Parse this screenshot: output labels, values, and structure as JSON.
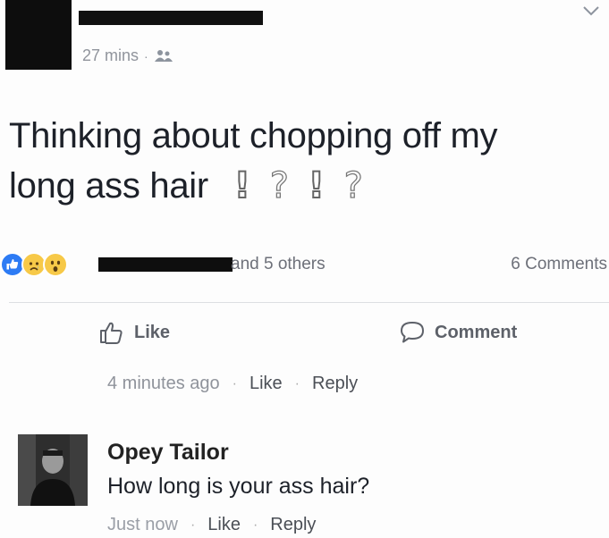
{
  "post": {
    "time": "27 mins",
    "separator": "·",
    "audience_icon": "friends-icon",
    "text_line1": "Thinking about chopping off my",
    "text_line2": "long ass hair",
    "marks": [
      "!",
      "?",
      "!",
      "?"
    ]
  },
  "reactions": {
    "icons": [
      "like-reaction-icon",
      "sad-reaction-icon",
      "wow-reaction-icon"
    ],
    "others_text": "and 5 others",
    "comments_count": "6 Comments"
  },
  "actions": {
    "like_label": "Like",
    "comment_label": "Comment"
  },
  "comment1": {
    "time": "4 minutes ago",
    "like_label": "Like",
    "reply_label": "Reply",
    "dot": "·"
  },
  "comment2": {
    "author": "Opey Tailor",
    "text": "How long is your ass hair?",
    "time": "Just now",
    "like_label": "Like",
    "reply_label": "Reply",
    "dot": "·"
  },
  "colors": {
    "like_blue": "#2d7bf4",
    "reaction_yellow": "#f7c948",
    "meta_gray": "#90949c"
  }
}
